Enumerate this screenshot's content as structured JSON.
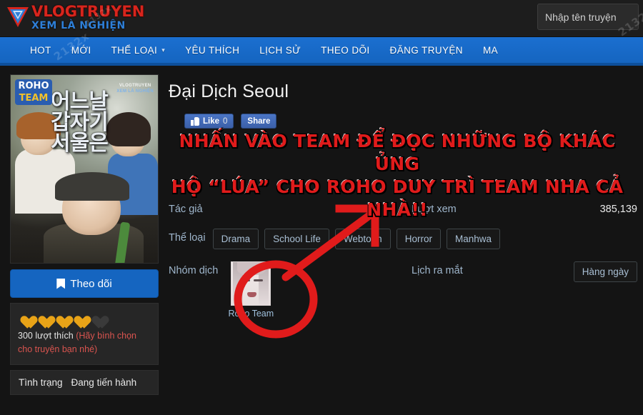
{
  "site": {
    "logo_title": "VLOGTRUYEN",
    "logo_subtitle": "XEM LÀ NGHIỆN",
    "watermark": "2132x"
  },
  "search": {
    "placeholder": "Nhập tên truyện",
    "value": ""
  },
  "nav": {
    "items": [
      {
        "label": "HOT",
        "caret": false
      },
      {
        "label": "MỚI",
        "caret": false
      },
      {
        "label": "THỂ LOẠI",
        "caret": true
      },
      {
        "label": "YÊU THÍCH",
        "caret": false
      },
      {
        "label": "LỊCH SỬ",
        "caret": false
      },
      {
        "label": "THEO DÕI",
        "caret": false
      },
      {
        "label": "ĐĂNG TRUYỆN",
        "caret": false
      },
      {
        "label": "MA",
        "caret": false
      }
    ],
    "caret_glyph": "▾"
  },
  "sidebar": {
    "cover": {
      "team_badge_line1": "ROHO",
      "team_badge_line2": "TEAM",
      "korean_line1": "어느날",
      "korean_line2": "갑자기",
      "korean_line3": "서울은",
      "watermark_line1": "VLOGTRUYEN",
      "watermark_line2": "XEM LÀ NGHIỆN"
    },
    "follow_button": "Theo dõi",
    "rating": {
      "filled": 4,
      "total": 5,
      "likes_text": "300 lượt thích",
      "likes_hint": "(Hãy bình chọn cho truyện bạn nhé)"
    },
    "status": {
      "label": "Tình trạng",
      "value": "Đang tiến hành"
    }
  },
  "main": {
    "title": "Đại Dịch Seoul",
    "social": {
      "like_label": "Like",
      "like_count": "0",
      "share_label": "Share"
    },
    "meta": {
      "author_label": "Tác giả",
      "author_value": "",
      "views_label": "Lượt xem",
      "views_value": "385,139",
      "genres_label": "Thể loại",
      "genres": [
        "Drama",
        "School Life",
        "Webtoon",
        "Horror",
        "Manhwa"
      ],
      "team_label": "Nhóm dịch",
      "team_name": "Roho Team",
      "schedule_label": "Lịch ra mắt",
      "schedule_value": "Hàng ngày"
    }
  },
  "annotation": {
    "line1": "NHẤN VÀO TEAM ĐỂ ĐỌC NHỮNG BỘ KHÁC ỦNG",
    "line2": "HỘ “LÚA” CHO ROHO DUY TRÌ TEAM NHA CẢ NHÀ!!",
    "color": "#e01b1b"
  },
  "colors": {
    "nav_blue": "#1565c0",
    "accent_red": "#d8251d",
    "page_bg": "#141414",
    "heart": "#e8a317"
  }
}
